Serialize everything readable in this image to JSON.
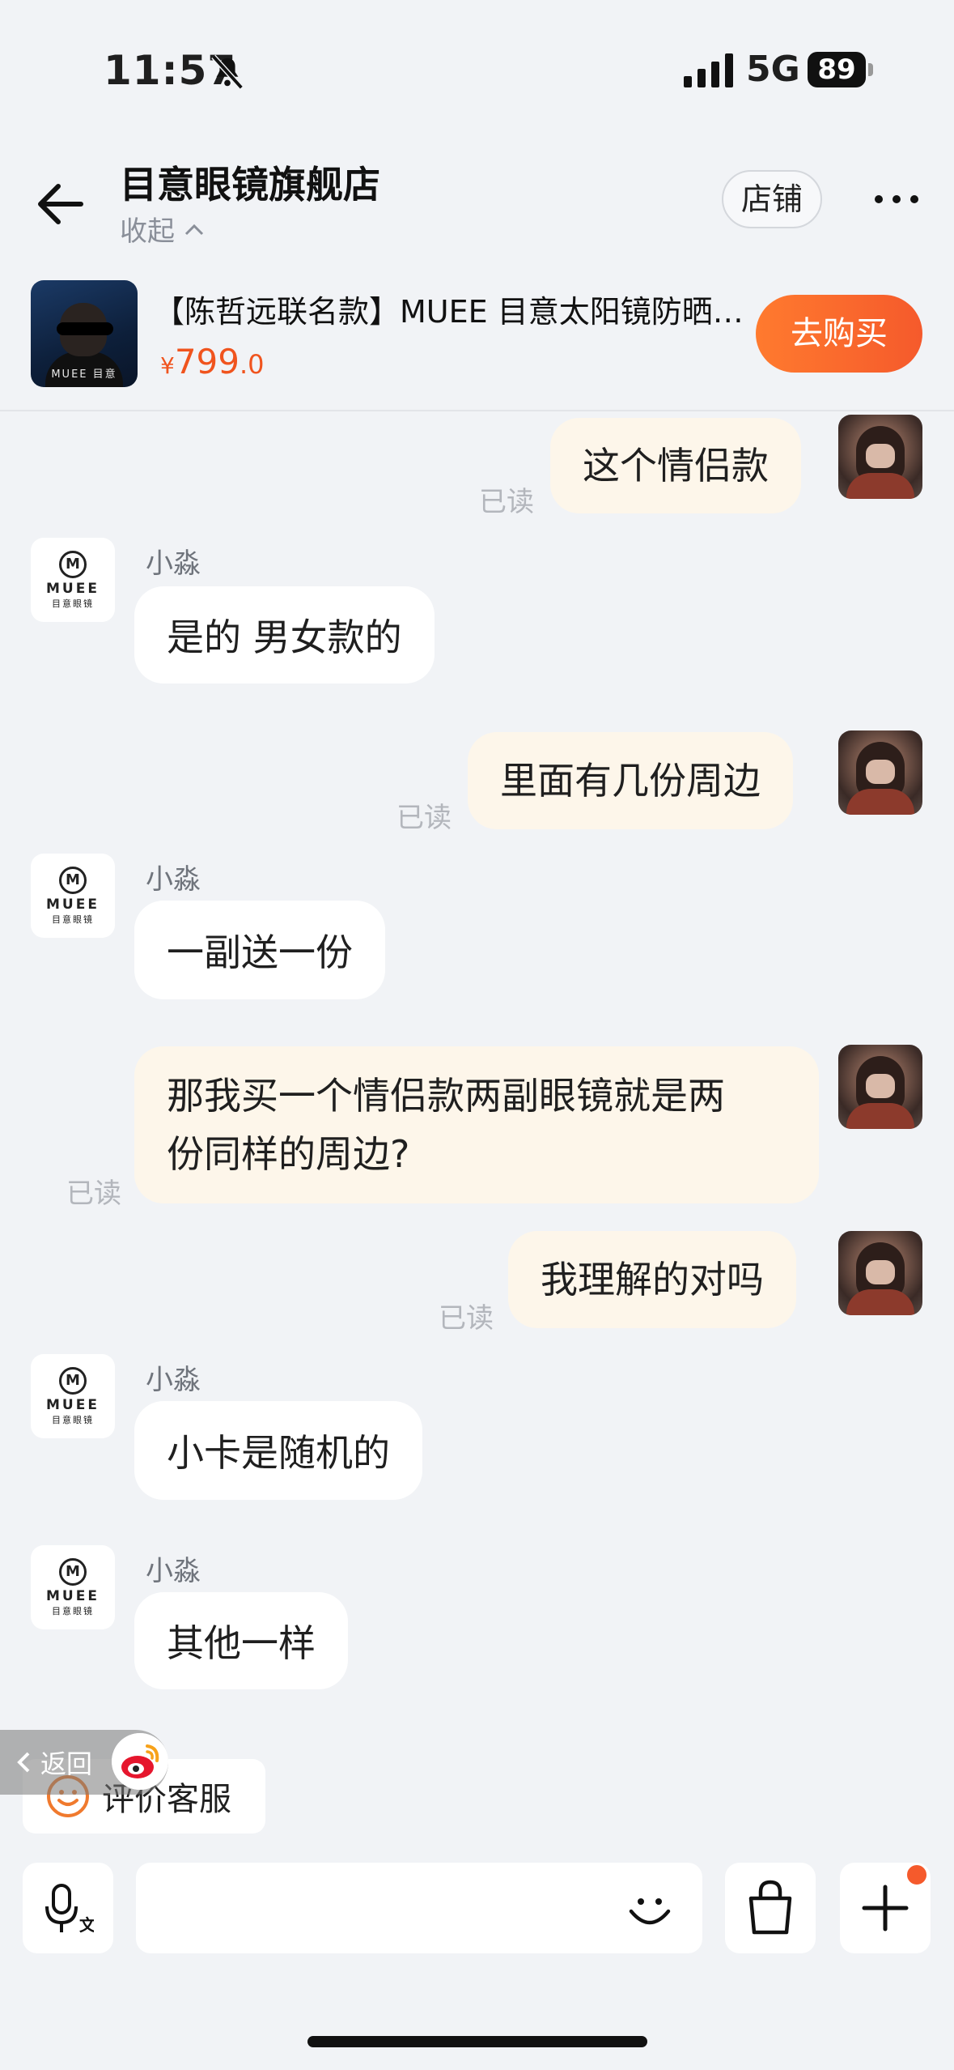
{
  "status_bar": {
    "time": "11:57",
    "network": "5G",
    "battery": "89",
    "icons": [
      "bell-slash-icon",
      "signal-icon"
    ]
  },
  "header": {
    "title": "目意眼镜旗舰店",
    "collapse_label": "收起",
    "store_button": "店铺",
    "icons": [
      "back-arrow-icon",
      "chevron-up-icon",
      "more-icon"
    ]
  },
  "product": {
    "title": "【陈哲远联名款】MUEE 目意太阳镜防晒…",
    "price_symbol": "¥",
    "price_main": "799",
    "price_decimal": ".0",
    "buy_button": "去购买",
    "image_brand_text": "MUEE 目意"
  },
  "messages": [
    {
      "from": "self",
      "text": "这个情侣款",
      "read": "已读"
    },
    {
      "from": "shop",
      "sender": "小淼",
      "text": "是的 男女款的"
    },
    {
      "from": "self",
      "text": "里面有几份周边",
      "read": "已读"
    },
    {
      "from": "shop",
      "sender": "小淼",
      "text": "一副送一份"
    },
    {
      "from": "self",
      "text_line1": "那我买一个情侣款两副眼镜就是两",
      "text_line2": "份同样的周边?",
      "read": "已读"
    },
    {
      "from": "self",
      "text": "我理解的对吗",
      "read": "已读"
    },
    {
      "from": "shop",
      "sender": "小淼",
      "text": "小卡是随机的"
    },
    {
      "from": "shop",
      "sender": "小淼",
      "text": "其他一样"
    }
  ],
  "shop_avatar": {
    "logo": "M",
    "brand": "MUEE",
    "cn": "目意眼镜"
  },
  "bottom": {
    "back_label": "返回",
    "rate_label": "评价客服",
    "input_placeholder": "",
    "icons": [
      "microphone-translate-icon",
      "emoji-icon",
      "shopping-bag-icon",
      "plus-icon",
      "weibo-icon",
      "smile-icon"
    ]
  },
  "colors": {
    "accent": "#f55a2c",
    "price": "#f0541e",
    "self_bubble": "#fdf6ea",
    "other_bubble": "#ffffff",
    "background": "#f1f3f6"
  }
}
